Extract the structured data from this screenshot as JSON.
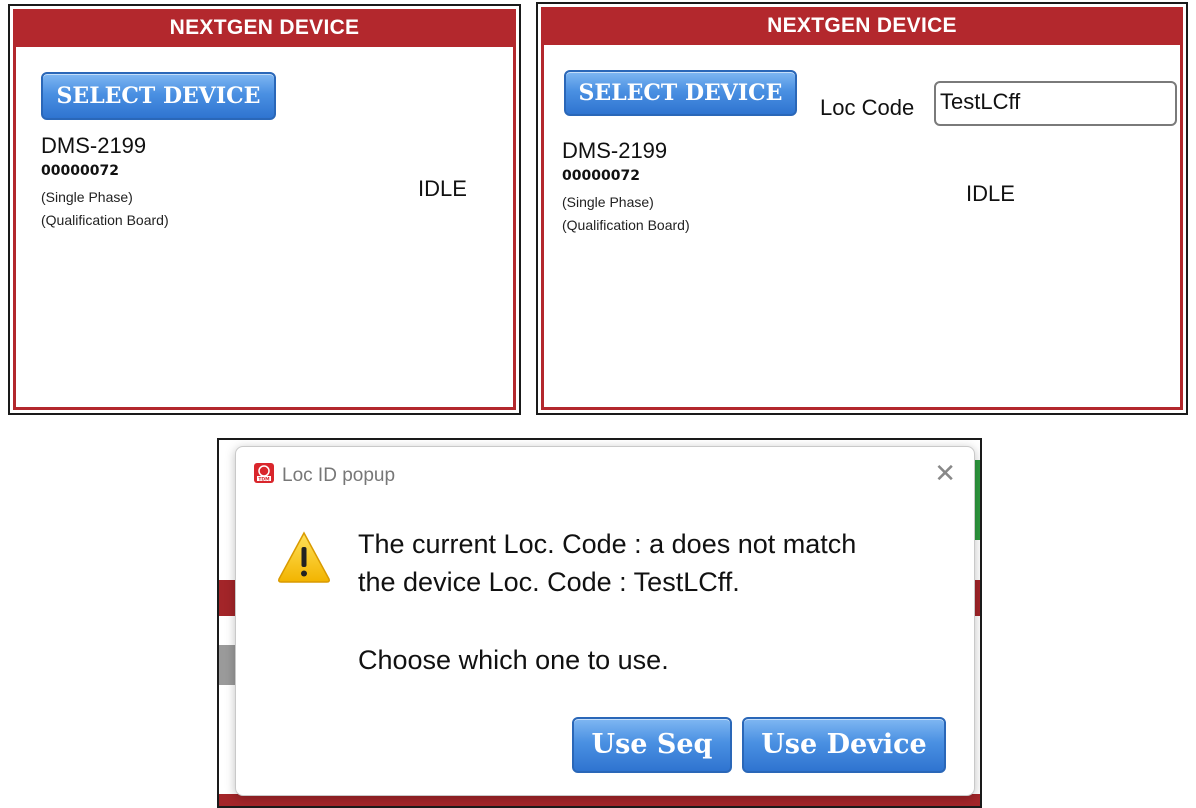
{
  "panel_left": {
    "header": "NEXTGEN DEVICE",
    "select_button": "SELECT DEVICE",
    "device_name": "DMS-2199",
    "serial": "00000072",
    "phase": "(Single Phase)",
    "board": "(Qualification Board)",
    "status": "IDLE"
  },
  "panel_right": {
    "header": "NEXTGEN DEVICE",
    "select_button": "SELECT DEVICE",
    "loc_code_label": "Loc Code",
    "loc_code_value": "TestLCff",
    "device_name": "DMS-2199",
    "serial": "00000072",
    "phase": "(Single Phase)",
    "board": "(Qualification Board)",
    "status": "IDLE"
  },
  "dialog": {
    "app_icon": "tdm-logo-icon",
    "title": "Loc ID popup",
    "close_glyph": "✕",
    "warning_icon": "warning-triangle-icon",
    "message_line1": "The current Loc. Code : a does not match",
    "message_line2": "the device Loc. Code : TestLCff.",
    "message_line3": "Choose which one to use.",
    "use_seq_button": "Use Seq",
    "use_device_button": "Use Device"
  },
  "colors": {
    "header_red": "#b3282d",
    "button_blue": "#4a90e2",
    "warning_yellow": "#f5c400"
  }
}
